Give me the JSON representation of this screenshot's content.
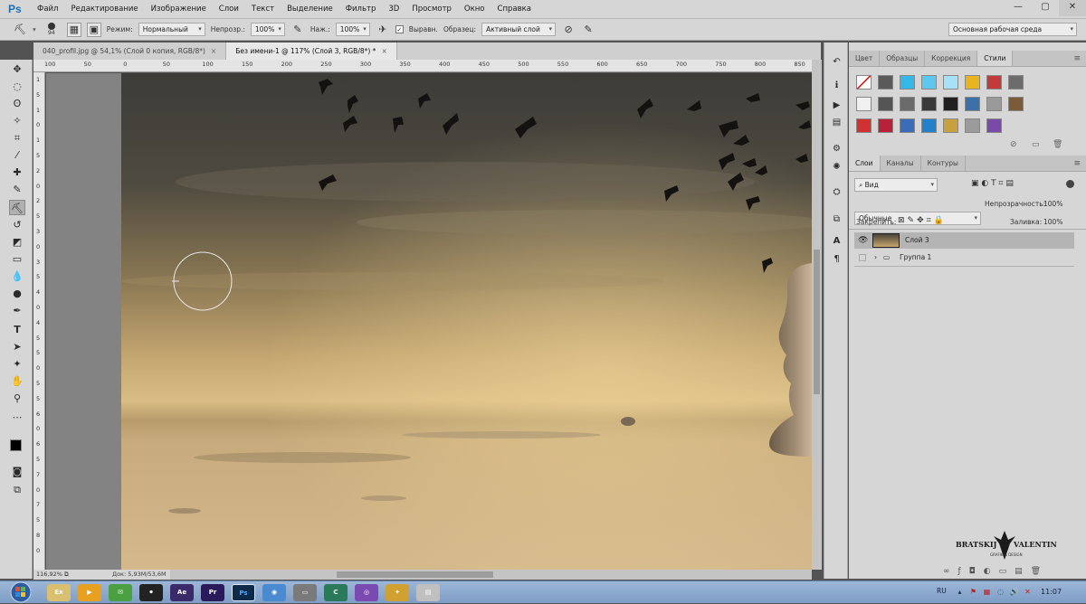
{
  "app": {
    "logo": "Ps",
    "menu": [
      "Файл",
      "Редактирование",
      "Изображение",
      "Слои",
      "Текст",
      "Выделение",
      "Фильтр",
      "3D",
      "Просмотр",
      "Окно",
      "Справка"
    ],
    "window_controls": [
      "—",
      "▢",
      "✕"
    ]
  },
  "options": {
    "brush_size": "94",
    "mode_label": "Режим:",
    "mode_value": "Нормальный",
    "opacity_label": "Непрозр.:",
    "opacity_value": "100%",
    "pressure_label": "Наж.:",
    "pressure_value": "100%",
    "aligned_label": "Выравн.",
    "sample_label": "Образец:",
    "sample_value": "Активный слой",
    "workspace": "Основная рабочая среда"
  },
  "tabs": [
    {
      "label": "040_profil.jpg @ 54,1% (Слой 0 копия, RGB/8*)",
      "close": "×"
    },
    {
      "label": "Без имени-1 @ 117% (Слой 3, RGB/8*) *",
      "close": "×"
    }
  ],
  "ruler": {
    "h": [
      "100",
      "50",
      "0",
      "50",
      "100",
      "150",
      "200",
      "250",
      "300",
      "350",
      "400",
      "450",
      "500",
      "550",
      "600",
      "650",
      "700",
      "750",
      "800",
      "850"
    ],
    "v": [
      "1",
      "5",
      "1",
      "0",
      "1",
      "5",
      "2",
      "0",
      "2",
      "5",
      "3",
      "0",
      "3",
      "5",
      "4",
      "0",
      "4",
      "5",
      "5",
      "0",
      "5",
      "5",
      "6",
      "0",
      "6",
      "5",
      "7",
      "0",
      "7",
      "5",
      "8",
      "0"
    ]
  },
  "status": {
    "zoom": "116,92%",
    "doc": "Док: 5,93M/53,6M"
  },
  "panels": {
    "top_tabs": [
      "Цвет",
      "Образцы",
      "Коррекция",
      "Стили"
    ],
    "layers_tabs": [
      "Слои",
      "Каналы",
      "Контуры"
    ],
    "filter_kind": "Вид",
    "blend_mode": "Обычные",
    "opacity_label": "Непрозрачность:",
    "opacity_value": "100%",
    "lock_label": "Закрепить:",
    "fill_label": "Заливка:",
    "fill_value": "100%",
    "layers": [
      {
        "name": "Слой 3",
        "visible": true,
        "selected": true
      },
      {
        "name": "Группа 1",
        "visible": false,
        "selected": false
      }
    ],
    "footer_icons": [
      "link-icon",
      "fx-icon",
      "mask-icon",
      "adjustment-icon",
      "group-icon",
      "new-layer-icon",
      "trash-icon"
    ]
  },
  "taskbar": {
    "apps": [
      "Ex",
      "▶",
      "✉",
      "⚫",
      "Ae",
      "Pr",
      "Ps",
      "◉",
      "▭",
      "C",
      "◎",
      "✦",
      "▤"
    ],
    "lang": "RU",
    "clock": "11:07"
  },
  "watermark": {
    "name_left": "BRATSKIJ",
    "name_right": "VALENTIN",
    "sub": "GRAFIK & DESIGN"
  },
  "colors": {
    "accent": "#1c6fb5",
    "selected_layer": "#b4b4b4",
    "canvas_sky_top": "#3b3a36",
    "canvas_sand": "#c9ad7f"
  }
}
